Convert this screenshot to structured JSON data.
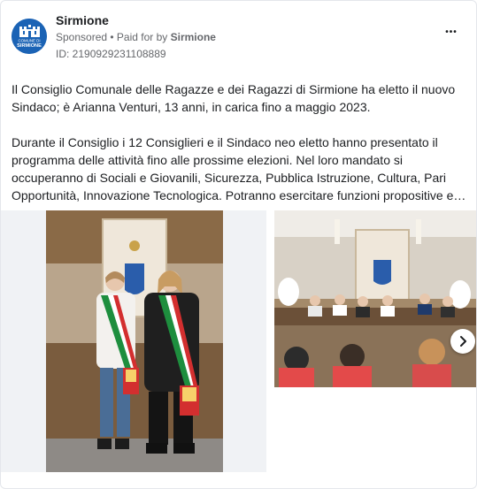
{
  "post": {
    "page_name": "Sirmione",
    "sponsored_label": "Sponsored",
    "paid_for_label": " • Paid for by ",
    "payer": "Sirmione",
    "ad_id": "ID: 2190929231108889",
    "more_label": "•••",
    "logo_text_line1": "COMUNE DI",
    "logo_text_line2": "SIRMIONE",
    "paragraph1": "Il Consiglio Comunale delle Ragazze e dei Ragazzi di Sirmione ha eletto il nuovo Sindaco; è Arianna Venturi, 13 anni, in carica fino a maggio 2023.",
    "paragraph2": "Durante il Consiglio i 12 Consiglieri e il Sindaco neo eletto hanno presentato il programma delle attività fino alle prossime elezioni. Nel loro mandato si occuperanno di Sociali e Giovanili, Sicurezza, Pubblica Istruzione, Cultura, Pari Opportunità, Innovazione Tecnologica. Potranno esercitare funzioni propositive e…"
  },
  "carousel": {
    "next_icon": "chevron-right-icon"
  },
  "colors": {
    "brand_blue": "#1b63b5",
    "sash_green": "#1e8e3e",
    "sash_red": "#d32f2f"
  }
}
